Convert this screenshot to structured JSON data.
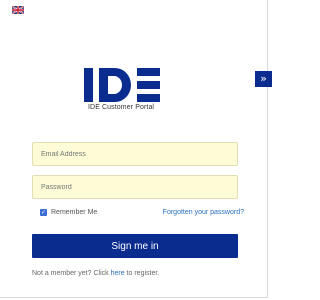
{
  "language": {
    "flag_icon": "uk-flag-icon"
  },
  "side_toggle": {
    "icon": "double-chevron-right-icon",
    "glyph": "»",
    "color": "#0b2c8f"
  },
  "branding": {
    "logo_text": "IDE",
    "portal_name": "IDE Customer Portal",
    "logo_color": "#0b2c8f"
  },
  "form": {
    "email": {
      "placeholder": "Email Address",
      "value": ""
    },
    "password": {
      "placeholder": "Password",
      "value": ""
    },
    "remember_me": {
      "label": "Remember Me",
      "checked": true
    },
    "forgot_link": "Forgotten your password?",
    "submit_label": "Sign me in",
    "field_bg": "#fdfcd7"
  },
  "register": {
    "prefix": "Not a member yet? Click",
    "link": "here",
    "suffix": "to register."
  }
}
